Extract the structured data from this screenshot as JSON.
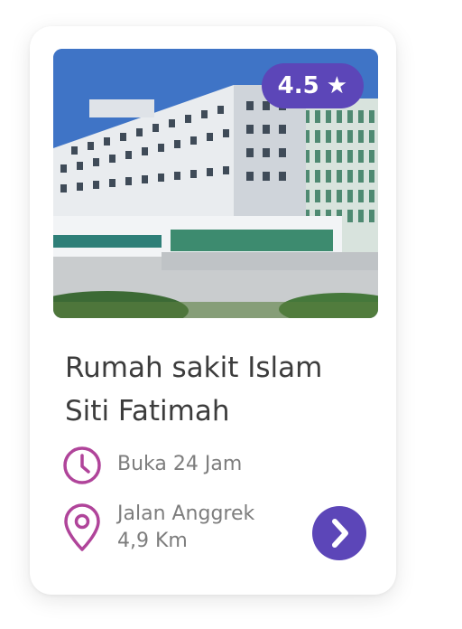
{
  "card": {
    "rating": "4.5",
    "rating_icon": "star-icon",
    "title_line1": "Rumah sakit Islam",
    "title_line2": "Siti Fatimah",
    "hours": {
      "icon": "clock-icon",
      "label": "Buka 24 Jam"
    },
    "location": {
      "icon": "map-pin-icon",
      "street": "Jalan Anggrek",
      "distance": "4,9 Km"
    },
    "go_button_icon": "chevron-right-icon"
  },
  "colors": {
    "accent": "#5c46b8",
    "icon_magenta": "#b0449a",
    "title_text": "#3c3c3c",
    "secondary_text": "#7d7d7d"
  }
}
